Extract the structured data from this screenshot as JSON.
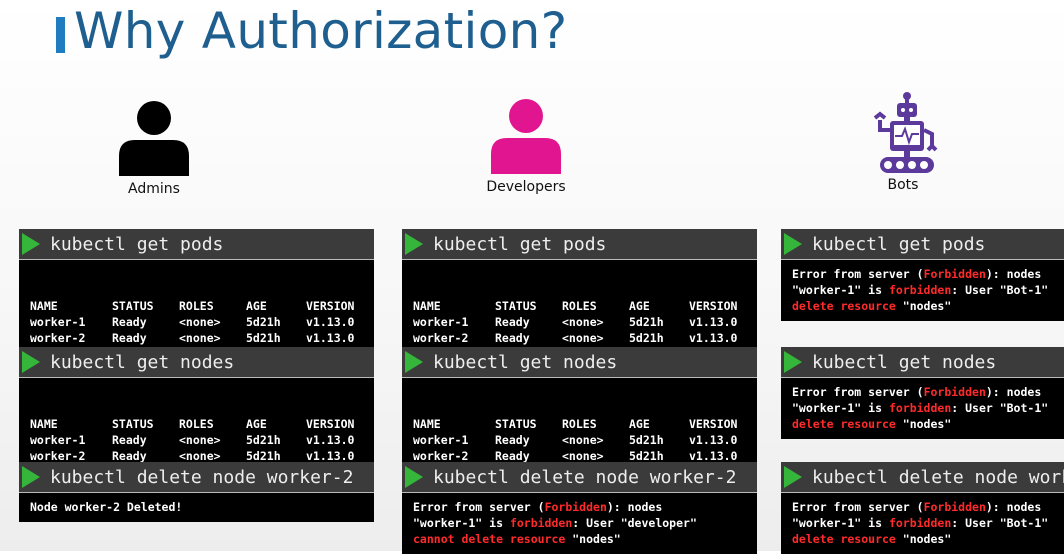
{
  "title": "Why Authorization?",
  "personas": [
    {
      "label": "Admins",
      "icon": "admin-user-icon",
      "color": "#000000"
    },
    {
      "label": "Developers",
      "icon": "developer-user-icon",
      "color": "#e0158f"
    },
    {
      "label": "Bots",
      "icon": "robot-icon",
      "color": "#5b3a9c"
    }
  ],
  "commands": {
    "get_pods": "kubectl get pods",
    "get_nodes": "kubectl get nodes",
    "delete_node": "kubectl delete node worker-2"
  },
  "table": {
    "headers": [
      "NAME",
      "STATUS",
      "ROLES",
      "AGE",
      "VERSION"
    ],
    "rows": [
      [
        "worker-1",
        "Ready",
        "<none>",
        "5d21h",
        "v1.13.0"
      ],
      [
        "worker-2",
        "Ready",
        "<none>",
        "5d21h",
        "v1.13.0"
      ]
    ]
  },
  "admin_delete_result": "Node worker-2 Deleted!",
  "error": {
    "prefix": "Error from server (",
    "forbidden_cap": "Forbidden",
    "suffix": "): nodes",
    "line2_a": "\"worker-1\" is ",
    "forbidden": "forbidden",
    "dev_user": ": User \"developer\"",
    "bot_user": ": User \"Bot-1\"",
    "dev_action": "cannot delete resource",
    "bot_action": "delete resource",
    "resource": " \"nodes\""
  }
}
